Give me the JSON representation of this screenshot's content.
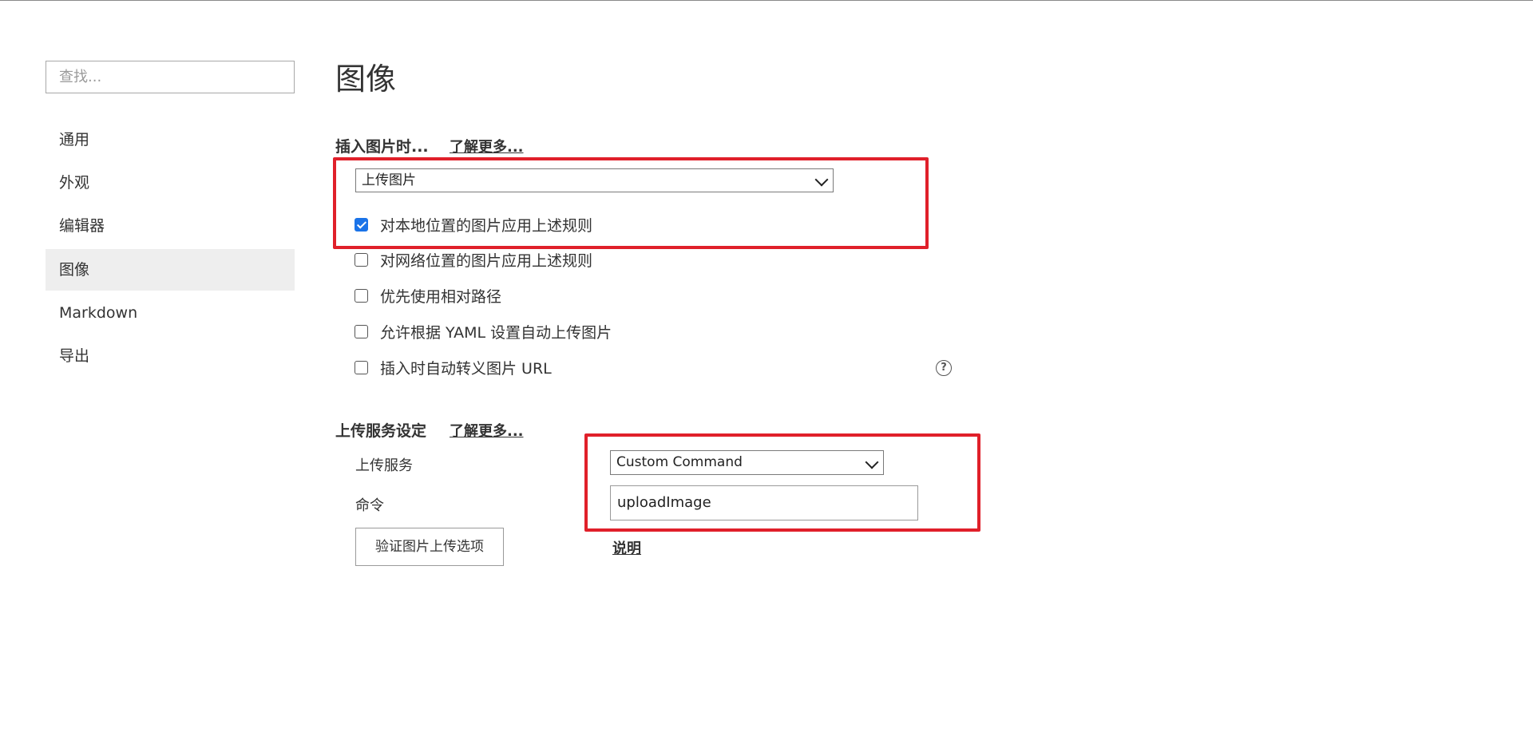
{
  "sidebar": {
    "search_placeholder": "查找...",
    "items": [
      {
        "label": "通用",
        "active": false
      },
      {
        "label": "外观",
        "active": false
      },
      {
        "label": "编辑器",
        "active": false
      },
      {
        "label": "图像",
        "active": true
      },
      {
        "label": "Markdown",
        "active": false
      },
      {
        "label": "导出",
        "active": false
      }
    ]
  },
  "main": {
    "title": "图像",
    "insert_section": {
      "title": "插入图片时...",
      "learn_more": "了解更多...",
      "action_selected": "上传图片",
      "options": [
        {
          "label": "对本地位置的图片应用上述规则",
          "checked": true
        },
        {
          "label": "对网络位置的图片应用上述规则",
          "checked": false
        },
        {
          "label": "优先使用相对路径",
          "checked": false
        },
        {
          "label": "允许根据 YAML 设置自动上传图片",
          "checked": false
        },
        {
          "label": "插入时自动转义图片 URL",
          "checked": false
        }
      ],
      "help_icon": "question-circle-icon"
    },
    "upload_section": {
      "title": "上传服务设定",
      "learn_more": "了解更多...",
      "service_label": "上传服务",
      "service_selected": "Custom Command",
      "command_label": "命令",
      "command_value": "uploadImage",
      "verify_button": "验证图片上传选项",
      "explain_link": "说明"
    }
  },
  "colors": {
    "highlight": "#e0202a",
    "checkbox_checked": "#1a73e8",
    "sidebar_active_bg": "#eeeeee"
  }
}
